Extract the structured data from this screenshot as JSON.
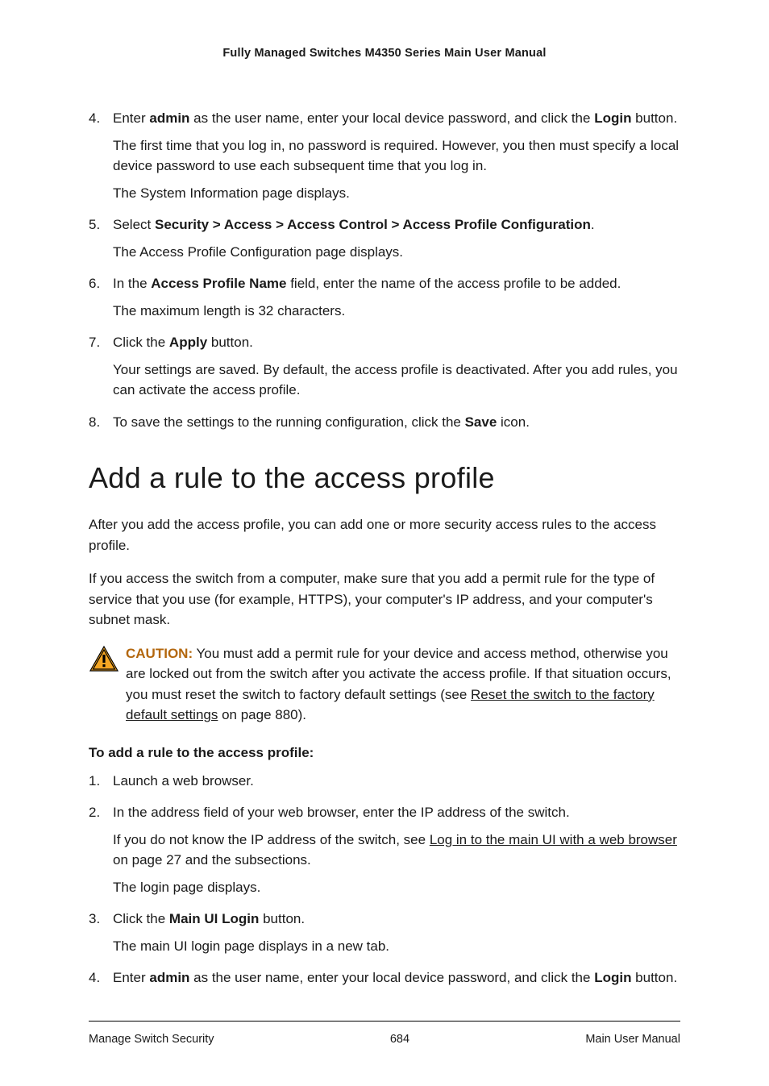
{
  "header": "Fully Managed Switches M4350 Series Main User Manual",
  "steps_a": [
    {
      "num": "4.",
      "paras": [
        {
          "segments": [
            {
              "t": "Enter "
            },
            {
              "t": "admin",
              "b": true
            },
            {
              "t": " as the user name, enter your local device password, and click the "
            },
            {
              "t": "Login",
              "b": true
            },
            {
              "t": " button."
            }
          ]
        },
        {
          "segments": [
            {
              "t": "The first time that you log in, no password is required. However, you then must specify a local device password to use each subsequent time that you log in."
            }
          ]
        },
        {
          "segments": [
            {
              "t": "The System Information page displays."
            }
          ]
        }
      ]
    },
    {
      "num": "5.",
      "paras": [
        {
          "segments": [
            {
              "t": "Select "
            },
            {
              "t": "Security > Access > Access Control > Access Profile Configuration",
              "b": true
            },
            {
              "t": "."
            }
          ]
        },
        {
          "segments": [
            {
              "t": "The Access Profile Configuration page displays."
            }
          ]
        }
      ]
    },
    {
      "num": "6.",
      "paras": [
        {
          "segments": [
            {
              "t": "In the "
            },
            {
              "t": "Access Profile Name",
              "b": true
            },
            {
              "t": " field, enter the name of the access profile to be added."
            }
          ]
        },
        {
          "segments": [
            {
              "t": "The maximum length is 32 characters."
            }
          ]
        }
      ]
    },
    {
      "num": "7.",
      "paras": [
        {
          "segments": [
            {
              "t": "Click the "
            },
            {
              "t": "Apply",
              "b": true
            },
            {
              "t": " button."
            }
          ]
        },
        {
          "segments": [
            {
              "t": "Your settings are saved. By default, the access profile is deactivated. After you add rules, you can activate the access profile."
            }
          ]
        }
      ]
    },
    {
      "num": "8.",
      "paras": [
        {
          "segments": [
            {
              "t": "To save the settings to the running configuration, click the "
            },
            {
              "t": "Save",
              "b": true
            },
            {
              "t": " icon."
            }
          ]
        }
      ]
    }
  ],
  "h2": "Add a rule to the access profile",
  "intro_paras": [
    "After you add the access profile, you can add one or more security access rules to the access profile.",
    "If you access the switch from a computer, make sure that you add a permit rule for the type of service that you use (for example, HTTPS), your computer's IP address, and your computer's subnet mask."
  ],
  "caution": {
    "label": "CAUTION:",
    "segments": [
      {
        "t": "  You must add a permit rule for your device and access method, otherwise you are locked out from the switch after you activate the access profile. If that situation occurs, you must reset the switch to factory default settings (see "
      },
      {
        "t": "Reset the switch to the factory default settings",
        "u": true
      },
      {
        "t": " on page 880)."
      }
    ]
  },
  "proc_heading": "To add a rule to the access profile:",
  "steps_b": [
    {
      "num": "1.",
      "paras": [
        {
          "segments": [
            {
              "t": "Launch a web browser."
            }
          ]
        }
      ]
    },
    {
      "num": "2.",
      "paras": [
        {
          "segments": [
            {
              "t": "In the address field of your web browser, enter the IP address of the switch."
            }
          ]
        },
        {
          "segments": [
            {
              "t": "If you do not know the IP address of the switch, see "
            },
            {
              "t": "Log in to the main UI with a web browser",
              "u": true
            },
            {
              "t": " on page 27 and the subsections."
            }
          ]
        },
        {
          "segments": [
            {
              "t": "The login page displays."
            }
          ]
        }
      ]
    },
    {
      "num": "3.",
      "paras": [
        {
          "segments": [
            {
              "t": "Click the "
            },
            {
              "t": "Main UI Login",
              "b": true
            },
            {
              "t": " button."
            }
          ]
        },
        {
          "segments": [
            {
              "t": "The main UI login page displays in a new tab."
            }
          ]
        }
      ]
    },
    {
      "num": "4.",
      "paras": [
        {
          "segments": [
            {
              "t": "Enter "
            },
            {
              "t": "admin",
              "b": true
            },
            {
              "t": " as the user name, enter your local device password, and click the "
            },
            {
              "t": "Login",
              "b": true
            },
            {
              "t": " button."
            }
          ]
        }
      ]
    }
  ],
  "footer": {
    "left": "Manage Switch Security",
    "center": "684",
    "right": "Main User Manual"
  }
}
